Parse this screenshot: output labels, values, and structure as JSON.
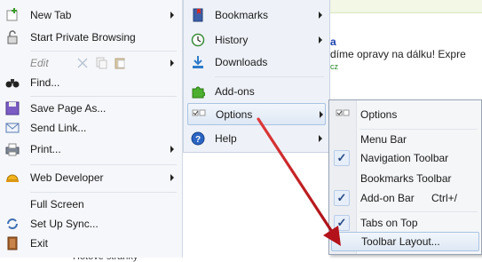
{
  "background": {
    "link_fragment": "a",
    "text": "díme opravy na dálku! Expre",
    "small_text": "cz",
    "partial_bottom": "Hotove stranky"
  },
  "left_menu": {
    "items": [
      {
        "label": "New Tab",
        "icon": "new-tab-icon"
      },
      {
        "label": "Start Private Browsing",
        "icon": "private-browsing-icon"
      },
      {
        "label": "Edit",
        "icon": "edit-icons"
      },
      {
        "label": "Find...",
        "icon": "binoculars-icon"
      },
      {
        "label": "Save Page As...",
        "icon": "save-icon"
      },
      {
        "label": "Send Link...",
        "icon": "envelope-icon"
      },
      {
        "label": "Print...",
        "icon": "printer-icon"
      },
      {
        "label": "Web Developer",
        "icon": "hardhat-icon"
      },
      {
        "label": "Full Screen",
        "icon": "fullscreen-icon"
      },
      {
        "label": "Set Up Sync...",
        "icon": "sync-icon"
      },
      {
        "label": "Exit",
        "icon": "exit-icon"
      }
    ]
  },
  "right_menu": {
    "items": [
      {
        "label": "Bookmarks",
        "icon": "bookmarks-icon"
      },
      {
        "label": "History",
        "icon": "history-icon"
      },
      {
        "label": "Downloads",
        "icon": "downloads-icon"
      },
      {
        "label": "Add-ons",
        "icon": "addons-icon"
      },
      {
        "label": "Options",
        "icon": "options-icon"
      },
      {
        "label": "Help",
        "icon": "help-icon"
      }
    ]
  },
  "options_submenu": {
    "items": [
      {
        "label": "Options",
        "checked": false
      },
      {
        "label": "Menu Bar",
        "checked": false
      },
      {
        "label": "Navigation Toolbar",
        "checked": true
      },
      {
        "label": "Bookmarks Toolbar",
        "checked": false
      },
      {
        "label": "Add-on Bar",
        "checked": true,
        "shortcut": "Ctrl+/"
      },
      {
        "label": "Tabs on Top",
        "checked": true
      },
      {
        "label": "Toolbar Layout...",
        "checked": false
      }
    ]
  },
  "colors": {
    "annotation_arrow": "#c0141c",
    "selection": "#dde8f5",
    "check": "#274b87"
  }
}
